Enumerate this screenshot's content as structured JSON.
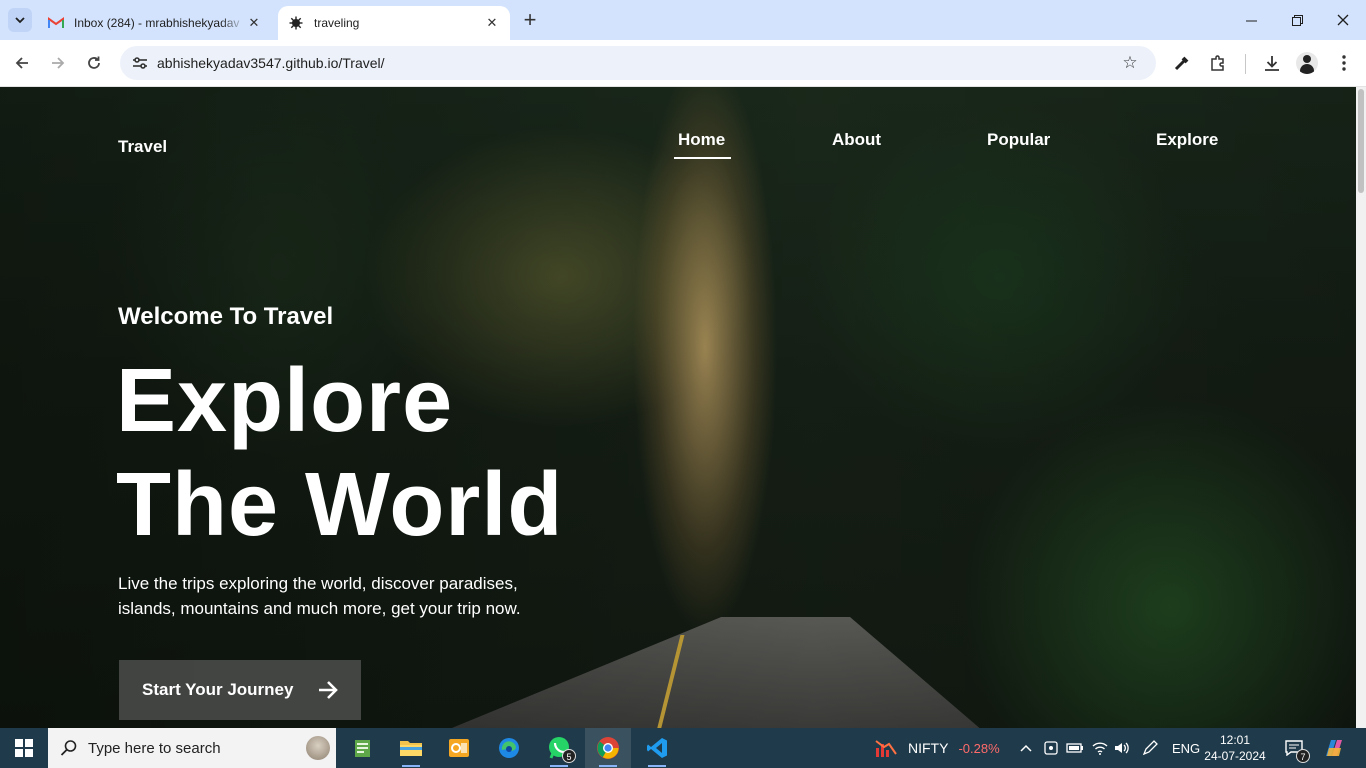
{
  "browser": {
    "tabs": [
      {
        "title": "Inbox (284) - mrabhishekyadav",
        "favicon": "gmail-icon"
      },
      {
        "title": "traveling",
        "favicon": "site-icon"
      }
    ],
    "url": "abhishekyadav3547.github.io/Travel/"
  },
  "site": {
    "logo": "Travel",
    "nav": [
      "Home",
      "About",
      "Popular",
      "Explore"
    ],
    "active_nav": "Home",
    "subtitle": "Welcome To Travel",
    "headline_line1": "Explore",
    "headline_line2": "The World",
    "description": "Live the trips exploring the world, discover paradises, islands, mountains and much more, get your trip now.",
    "cta_label": "Start Your Journey"
  },
  "taskbar": {
    "search_placeholder": "Type here to search",
    "apps": [
      "notepad-icon",
      "file-explorer-icon",
      "outlook-icon",
      "edge-icon",
      "whatsapp-icon",
      "chrome-icon",
      "vscode-icon"
    ],
    "whatsapp_badge": "5",
    "stock_name": "NIFTY",
    "stock_change": "-0.28%",
    "language": "ENG",
    "time": "12:01",
    "date": "24-07-2024",
    "notification_count": "7"
  },
  "colors": {
    "tab_strip": "#d3e3fd",
    "omnibox": "#edf2fa",
    "taskbar": "#1f3a4a",
    "stock_negative": "#ff6b6b"
  }
}
